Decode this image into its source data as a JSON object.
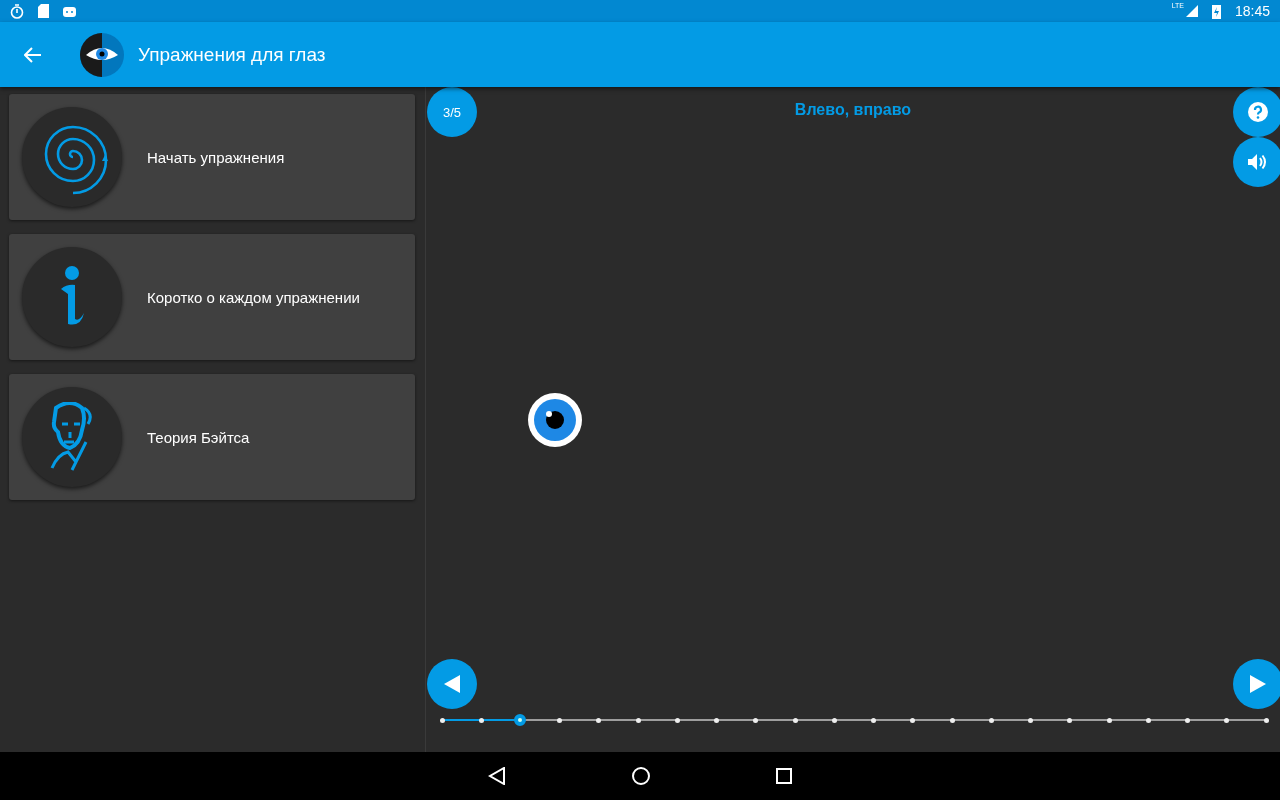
{
  "status_bar": {
    "time": "18:45",
    "network": "LTE"
  },
  "toolbar": {
    "title": "Упражнения для глаз"
  },
  "menu": [
    {
      "label": "Начать упражнения",
      "kind": "spiral"
    },
    {
      "label": "Коротко о каждом упражнении",
      "kind": "info"
    },
    {
      "label": "Теория Бэйтса",
      "kind": "portrait"
    }
  ],
  "exercise": {
    "counter": "3/5",
    "title": "Влево, вправо",
    "progress": {
      "level": 0.095
    }
  }
}
